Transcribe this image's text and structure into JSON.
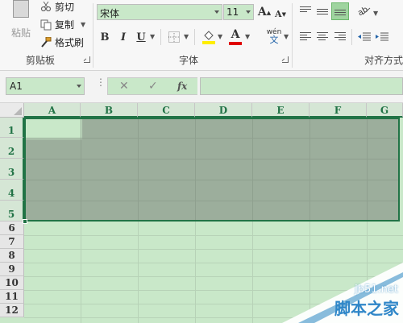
{
  "ribbon": {
    "clipboard": {
      "paste_label": "粘贴",
      "cut_label": "剪切",
      "copy_label": "复制",
      "format_painter_label": "格式刷",
      "group_label": "剪贴板"
    },
    "font": {
      "font_name": "宋体",
      "font_size": "11",
      "grow_label": "A",
      "shrink_label": "A",
      "bold_label": "B",
      "italic_label": "I",
      "underline_label": "U",
      "phonetic_label": "wén",
      "phonetic_sub": "文",
      "font_color_label": "A",
      "group_label": "字体"
    },
    "alignment": {
      "group_label": "对齐方式"
    }
  },
  "formula_bar": {
    "name_box": "A1",
    "fx_label": "fx",
    "formula": ""
  },
  "grid": {
    "columns": [
      "A",
      "B",
      "C",
      "D",
      "E",
      "F",
      "G"
    ],
    "rows": [
      "1",
      "2",
      "3",
      "4",
      "5",
      "6",
      "7",
      "8",
      "9",
      "10",
      "11",
      "12"
    ],
    "selected_range": "A1:G5",
    "active_cell": "A1"
  },
  "colors": {
    "accent": "#217346",
    "cell_background": "#c9e8c9",
    "selection_fill": "#9cae9c",
    "font_color_bar": "#e00000",
    "highlight_bar": "#ffee00"
  },
  "watermark": {
    "site": "jb51.net",
    "name": "脚本之家"
  }
}
